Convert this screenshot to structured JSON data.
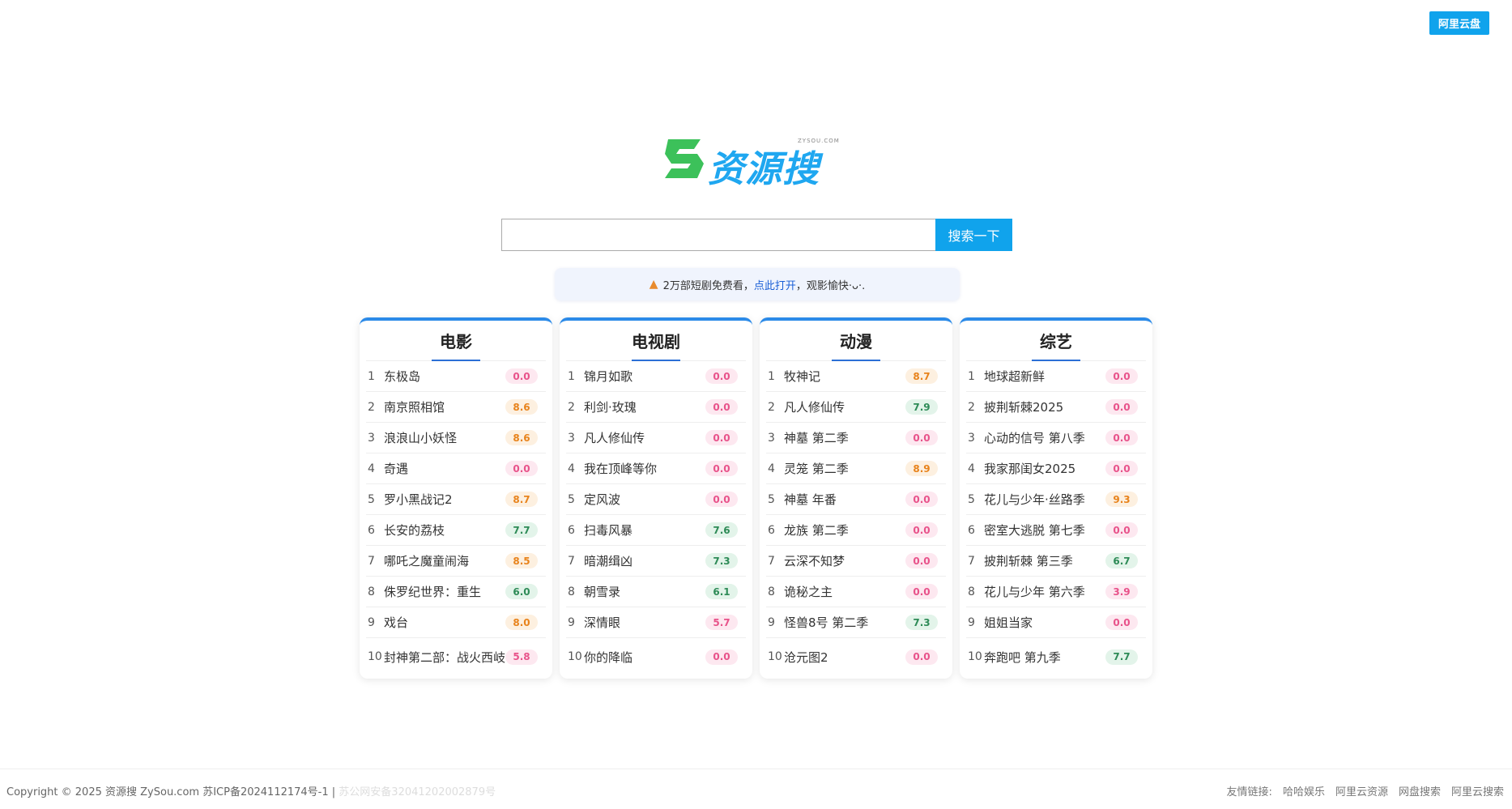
{
  "header": {
    "top_button": "阿里云盘"
  },
  "logo": {
    "text": "资源搜",
    "sub": "ZYSOU.COM",
    "s_color": "#3cc15a",
    "text_color": "#1fa7f0"
  },
  "search": {
    "placeholder": "",
    "value": "",
    "button": "搜索一下"
  },
  "notice": {
    "prefix": "2万部短剧免费看，",
    "link": "点此打开",
    "suffix": "，观影愉快·ᴗ·."
  },
  "columns": [
    {
      "title": "电影",
      "items": [
        {
          "rank": "1",
          "name": "东极岛",
          "score": "0.0",
          "tone": "pink"
        },
        {
          "rank": "2",
          "name": "南京照相馆",
          "score": "8.6",
          "tone": "orange"
        },
        {
          "rank": "3",
          "name": "浪浪山小妖怪",
          "score": "8.6",
          "tone": "orange"
        },
        {
          "rank": "4",
          "name": "奇遇",
          "score": "0.0",
          "tone": "pink"
        },
        {
          "rank": "5",
          "name": "罗小黑战记2",
          "score": "8.7",
          "tone": "orange"
        },
        {
          "rank": "6",
          "name": "长安的荔枝",
          "score": "7.7",
          "tone": "green"
        },
        {
          "rank": "7",
          "name": "哪吒之魔童闹海",
          "score": "8.5",
          "tone": "orange"
        },
        {
          "rank": "8",
          "name": "侏罗纪世界：重生",
          "score": "6.0",
          "tone": "green"
        },
        {
          "rank": "9",
          "name": "戏台",
          "score": "8.0",
          "tone": "orange"
        },
        {
          "rank": "10",
          "name": "封神第二部：战火西岐",
          "score": "5.8",
          "tone": "pink"
        }
      ]
    },
    {
      "title": "电视剧",
      "items": [
        {
          "rank": "1",
          "name": "锦月如歌",
          "score": "0.0",
          "tone": "pink"
        },
        {
          "rank": "2",
          "name": "利剑·玫瑰",
          "score": "0.0",
          "tone": "pink"
        },
        {
          "rank": "3",
          "name": "凡人修仙传",
          "score": "0.0",
          "tone": "pink"
        },
        {
          "rank": "4",
          "name": "我在顶峰等你",
          "score": "0.0",
          "tone": "pink"
        },
        {
          "rank": "5",
          "name": "定风波",
          "score": "0.0",
          "tone": "pink"
        },
        {
          "rank": "6",
          "name": "扫毒风暴",
          "score": "7.6",
          "tone": "green"
        },
        {
          "rank": "7",
          "name": "暗潮缉凶",
          "score": "7.3",
          "tone": "green"
        },
        {
          "rank": "8",
          "name": "朝雪录",
          "score": "6.1",
          "tone": "green"
        },
        {
          "rank": "9",
          "name": "深情眼",
          "score": "5.7",
          "tone": "pink"
        },
        {
          "rank": "10",
          "name": "你的降临",
          "score": "0.0",
          "tone": "pink"
        }
      ]
    },
    {
      "title": "动漫",
      "items": [
        {
          "rank": "1",
          "name": "牧神记",
          "score": "8.7",
          "tone": "orange"
        },
        {
          "rank": "2",
          "name": "凡人修仙传",
          "score": "7.9",
          "tone": "green"
        },
        {
          "rank": "3",
          "name": "神墓 第二季",
          "score": "0.0",
          "tone": "pink"
        },
        {
          "rank": "4",
          "name": "灵笼 第二季",
          "score": "8.9",
          "tone": "orange"
        },
        {
          "rank": "5",
          "name": "神墓 年番",
          "score": "0.0",
          "tone": "pink"
        },
        {
          "rank": "6",
          "name": "龙族 第二季",
          "score": "0.0",
          "tone": "pink"
        },
        {
          "rank": "7",
          "name": "云深不知梦",
          "score": "0.0",
          "tone": "pink"
        },
        {
          "rank": "8",
          "name": "诡秘之主",
          "score": "0.0",
          "tone": "pink"
        },
        {
          "rank": "9",
          "name": "怪兽8号 第二季",
          "score": "7.3",
          "tone": "green"
        },
        {
          "rank": "10",
          "name": "沧元图2",
          "score": "0.0",
          "tone": "pink"
        }
      ]
    },
    {
      "title": "综艺",
      "items": [
        {
          "rank": "1",
          "name": "地球超新鲜",
          "score": "0.0",
          "tone": "pink"
        },
        {
          "rank": "2",
          "name": "披荆斩棘2025",
          "score": "0.0",
          "tone": "pink"
        },
        {
          "rank": "3",
          "name": "心动的信号 第八季",
          "score": "0.0",
          "tone": "pink"
        },
        {
          "rank": "4",
          "name": "我家那闺女2025",
          "score": "0.0",
          "tone": "pink"
        },
        {
          "rank": "5",
          "name": "花儿与少年·丝路季",
          "score": "9.3",
          "tone": "orange"
        },
        {
          "rank": "6",
          "name": "密室大逃脱 第七季",
          "score": "0.0",
          "tone": "pink"
        },
        {
          "rank": "7",
          "name": "披荆斩棘 第三季",
          "score": "6.7",
          "tone": "green"
        },
        {
          "rank": "8",
          "name": "花儿与少年 第六季",
          "score": "3.9",
          "tone": "pink"
        },
        {
          "rank": "9",
          "name": "姐姐当家",
          "score": "0.0",
          "tone": "pink"
        },
        {
          "rank": "10",
          "name": "奔跑吧 第九季",
          "score": "7.7",
          "tone": "green"
        }
      ]
    }
  ],
  "footer": {
    "copyright": "Copyright © 2025 资源搜 ZySou.com",
    "icp": "苏ICP备2024112174号-1 |",
    "gongan": "苏公网安备32041202002879号",
    "links_label": "友情链接:",
    "links": [
      "哈哈娱乐",
      "阿里云资源",
      "网盘搜索",
      "阿里云搜索"
    ]
  },
  "colors": {
    "accent": "#10a3ec",
    "card_top": "#2b8ae8"
  }
}
